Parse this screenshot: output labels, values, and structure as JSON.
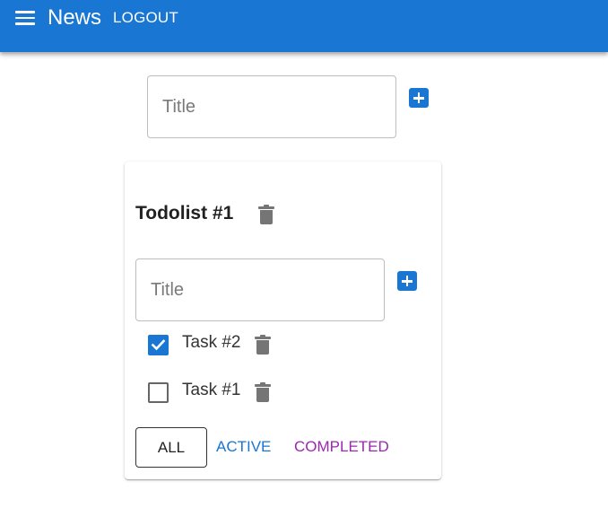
{
  "appbar": {
    "title": "News",
    "logout_label": "LOGOUT",
    "color": "#1976d2"
  },
  "add_list": {
    "placeholder": "Title"
  },
  "todolist": {
    "title": "Todolist #1",
    "add_task_placeholder": "Title",
    "tasks": [
      {
        "label": "Task #2",
        "done": true
      },
      {
        "label": "Task #1",
        "done": false
      }
    ],
    "filters": {
      "all": "ALL",
      "active": "ACTIVE",
      "completed": "COMPLETED",
      "selected": "all"
    }
  },
  "icons": {
    "menu": "menu-icon",
    "add": "plus-square-icon",
    "delete": "trash-icon",
    "checked": "checkbox-checked-icon",
    "unchecked": "checkbox-unchecked-icon"
  },
  "colors": {
    "primary": "#1976d2",
    "secondary": "#9c27b0",
    "icon_grey": "#757575"
  }
}
